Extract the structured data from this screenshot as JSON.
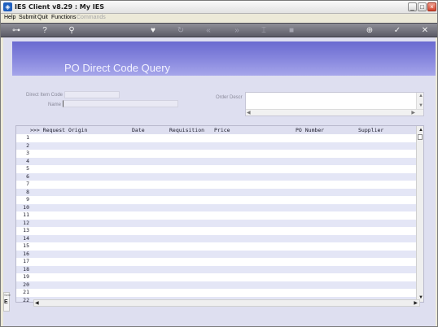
{
  "window": {
    "title": "IES Client v8.29 : My IES",
    "app_icon": "IES",
    "controls": {
      "minimize": "_",
      "maximize": "□",
      "close": "×"
    }
  },
  "menubar": {
    "items": [
      {
        "label": "Help",
        "enabled": true
      },
      {
        "label": "Submit",
        "enabled": true
      },
      {
        "label": "Quit",
        "enabled": true
      },
      {
        "label": "Functions",
        "enabled": true
      },
      {
        "label": "Commands",
        "enabled": false
      }
    ]
  },
  "toolbar": {
    "icons": [
      "key-icon",
      "help-icon",
      "search-icon",
      "heart-icon",
      "refresh-icon",
      "rewind-icon",
      "fast-forward-icon",
      "bookmark-icon",
      "stop-icon",
      "globe-icon",
      "check-icon",
      "close-icon"
    ]
  },
  "page": {
    "title": "PO Direct Code Query"
  },
  "form": {
    "direct_item_code_label": "Direct Item Code",
    "direct_item_code_value": "",
    "name_label": "Name",
    "name_value": "",
    "order_descr_label": "Order Descr",
    "order_descr_value": ""
  },
  "grid": {
    "columns": [
      ">>> Request Origin",
      "Date",
      "Requisition",
      "Price",
      "PO Number",
      "Supplier"
    ],
    "row_numbers": [
      "1",
      "2",
      "3",
      "4",
      "5",
      "6",
      "7",
      "8",
      "9",
      "10",
      "11",
      "12",
      "13",
      "14",
      "15",
      "16",
      "17",
      "18",
      "19",
      "20",
      "21",
      "22"
    ]
  },
  "side_stub": {
    "top": "Sele",
    "bottom": "E"
  },
  "colors": {
    "header_band": "#7a7ad8",
    "content_bg": "#dedff0",
    "alt_row": "#e4e6f6",
    "title_text": "#f2f2ff"
  }
}
